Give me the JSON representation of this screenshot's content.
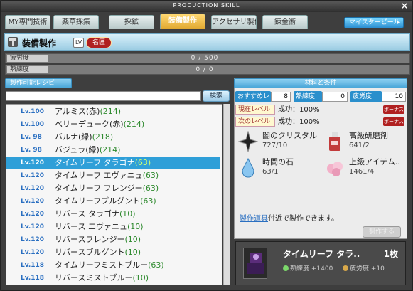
{
  "window": {
    "title": "PRODUCTION SKILL",
    "close": "×"
  },
  "tabs": [
    {
      "label": "MY専門技術",
      "active": false
    },
    {
      "label": "薬草採集",
      "active": false
    },
    {
      "label": "採鉱",
      "active": false
    },
    {
      "label": "装備製作",
      "active": true
    },
    {
      "label": "アクセサリ製作",
      "active": false
    },
    {
      "label": "錬金術",
      "active": false
    }
  ],
  "meister_button": {
    "label": "マイスタービール",
    "arrow": "▸"
  },
  "skill": {
    "name": "装備製作",
    "lv_prefix": "LV",
    "rank": "名匠"
  },
  "fatigue": {
    "label": "疲労度",
    "value": "0 / 500",
    "ratio": 0
  },
  "proficiency": {
    "label": "熟練度",
    "value": "0 / 0",
    "ratio": 0
  },
  "recipe_header": "製作可能レシピ",
  "search": {
    "value": "",
    "button": "検索"
  },
  "recipes": [
    {
      "lv": "Lv.100",
      "name": "アルミス(赤)",
      "count": "(214)",
      "selected": false
    },
    {
      "lv": "Lv.100",
      "name": "ベリーデューク(赤)",
      "count": "(214)",
      "selected": false
    },
    {
      "lv": "Lv. 98",
      "name": "バルナ(緑)",
      "count": "(218)",
      "selected": false
    },
    {
      "lv": "Lv. 98",
      "name": "バジュラ(緑)",
      "count": "(214)",
      "selected": false
    },
    {
      "lv": "Lv.120",
      "name": "タイムリーフ タラゴナ",
      "count": "(63)",
      "selected": true
    },
    {
      "lv": "Lv.120",
      "name": "タイムリーフ エヴァニュ",
      "count": "(63)",
      "selected": false
    },
    {
      "lv": "Lv.120",
      "name": "タイムリーフ フレンジー",
      "count": "(63)",
      "selected": false
    },
    {
      "lv": "Lv.120",
      "name": "タイムリーフブルグント",
      "count": "(63)",
      "selected": false
    },
    {
      "lv": "Lv.120",
      "name": "リバース タラゴナ",
      "count": "(10)",
      "selected": false
    },
    {
      "lv": "Lv.120",
      "name": "リバース エヴァニュ",
      "count": "(10)",
      "selected": false
    },
    {
      "lv": "Lv.120",
      "name": "リバースフレンジー",
      "count": "(10)",
      "selected": false
    },
    {
      "lv": "Lv.120",
      "name": "リバースブルグント",
      "count": "(10)",
      "selected": false
    },
    {
      "lv": "Lv.118",
      "name": "タイムリーフミストブルー",
      "count": "(63)",
      "selected": false
    },
    {
      "lv": "Lv.118",
      "name": "リバースミストブルー",
      "count": "(10)",
      "selected": false
    }
  ],
  "materials_header": "材料と条件",
  "conditions": {
    "recommend_label": "おすすめレベル",
    "recommend_value": "8",
    "prof_label": "熟練度",
    "prof_value": "0",
    "fatigue_label": "疲労度",
    "fatigue_value": "10"
  },
  "levels": [
    {
      "tag": "現在レベル",
      "text": "成功：100%",
      "bonus": "ボーナス"
    },
    {
      "tag": "次のレベル",
      "text": "成功：100%",
      "bonus": "ボーナス"
    }
  ],
  "materials": [
    {
      "name": "闇のクリスタル",
      "count": "727/10",
      "icon": "dark-crystal-icon"
    },
    {
      "name": "高級研磨剤",
      "count": "641/2",
      "icon": "polish-bottle-icon"
    },
    {
      "name": "時間の石",
      "count": "63/1",
      "icon": "time-stone-icon"
    },
    {
      "name": "上級アイテム..",
      "count": "1461/4",
      "icon": "advanced-item-icon"
    }
  ],
  "note": {
    "link": "製作道具",
    "text": "付近で製作できます。"
  },
  "make_button": "製作する",
  "result": {
    "name": "タイムリーフ タラ..",
    "count": "1枚",
    "prof_label": "熟練度",
    "prof_gain": "+1400",
    "fatigue_label": "疲労度",
    "fatigue_gain": "+10",
    "icon": "armor-icon"
  }
}
